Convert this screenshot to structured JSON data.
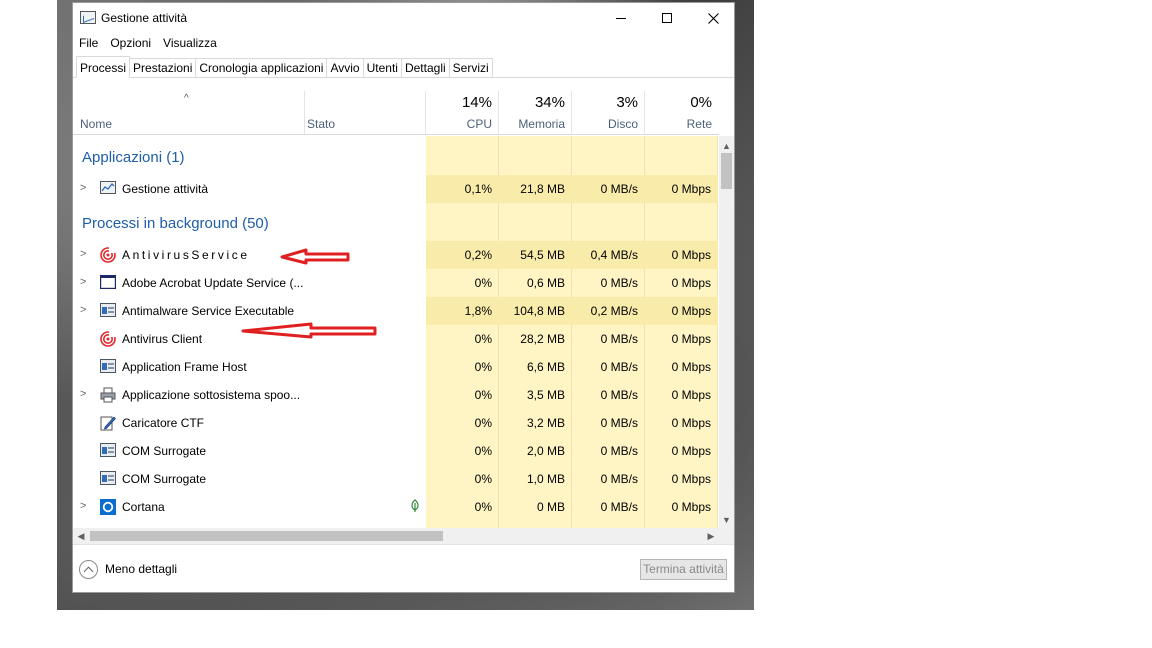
{
  "window": {
    "title": "Gestione attività"
  },
  "menu": [
    "File",
    "Opzioni",
    "Visualizza"
  ],
  "tabs": [
    "Processi",
    "Prestazioni",
    "Cronologia applicazioni",
    "Avvio",
    "Utenti",
    "Dettagli",
    "Servizi"
  ],
  "active_tab": "Processi",
  "columns": {
    "name": "Nome",
    "status": "Stato",
    "cpu": {
      "pct": "14%",
      "label": "CPU"
    },
    "memory": {
      "pct": "34%",
      "label": "Memoria"
    },
    "disk": {
      "pct": "3%",
      "label": "Disco"
    },
    "network": {
      "pct": "0%",
      "label": "Rete"
    }
  },
  "groups": {
    "apps": "Applicazioni (1)",
    "background": "Processi in background (50)"
  },
  "app_rows": [
    {
      "name": "Gestione attività",
      "icon": "task-manager-icon",
      "expandable": true,
      "cpu": "0,1%",
      "mem": "21,8 MB",
      "disk": "0 MB/s",
      "net": "0 Mbps"
    }
  ],
  "bg_rows": [
    {
      "name": "AntivirusService",
      "icon": "antivirus-icon",
      "expandable": true,
      "cpu": "0,2%",
      "mem": "54,5 MB",
      "disk": "0,4 MB/s",
      "net": "0 Mbps"
    },
    {
      "name": "Adobe Acrobat Update Service (...",
      "icon": "window-icon",
      "expandable": true,
      "cpu": "0%",
      "mem": "0,6 MB",
      "disk": "0 MB/s",
      "net": "0 Mbps"
    },
    {
      "name": "Antimalware Service Executable",
      "icon": "service-icon",
      "expandable": true,
      "cpu": "1,8%",
      "mem": "104,8 MB",
      "disk": "0,2 MB/s",
      "net": "0 Mbps"
    },
    {
      "name": "Antivirus Client",
      "icon": "antivirus-icon",
      "expandable": false,
      "cpu": "0%",
      "mem": "28,2 MB",
      "disk": "0 MB/s",
      "net": "0 Mbps"
    },
    {
      "name": "Application Frame Host",
      "icon": "service-icon",
      "expandable": false,
      "cpu": "0%",
      "mem": "6,6 MB",
      "disk": "0 MB/s",
      "net": "0 Mbps"
    },
    {
      "name": "Applicazione sottosistema spoo...",
      "icon": "printer-icon",
      "expandable": true,
      "cpu": "0%",
      "mem": "3,5 MB",
      "disk": "0 MB/s",
      "net": "0 Mbps"
    },
    {
      "name": "Caricatore CTF",
      "icon": "pen-icon",
      "expandable": false,
      "cpu": "0%",
      "mem": "3,2 MB",
      "disk": "0 MB/s",
      "net": "0 Mbps"
    },
    {
      "name": "COM Surrogate",
      "icon": "service-icon",
      "expandable": false,
      "cpu": "0%",
      "mem": "2,0 MB",
      "disk": "0 MB/s",
      "net": "0 Mbps"
    },
    {
      "name": "COM Surrogate",
      "icon": "service-icon",
      "expandable": false,
      "cpu": "0%",
      "mem": "1,0 MB",
      "disk": "0 MB/s",
      "net": "0 Mbps"
    },
    {
      "name": "Cortana",
      "icon": "cortana-icon",
      "expandable": true,
      "cpu": "0%",
      "mem": "0 MB",
      "disk": "0 MB/s",
      "net": "0 Mbps"
    }
  ],
  "footer": {
    "less_details": "Meno dettagli",
    "end_task": "Termina attività"
  },
  "colors": {
    "group_title": "#1f5ea8",
    "heat": "#fff4c4",
    "annotation_arrow": "#e02020"
  }
}
